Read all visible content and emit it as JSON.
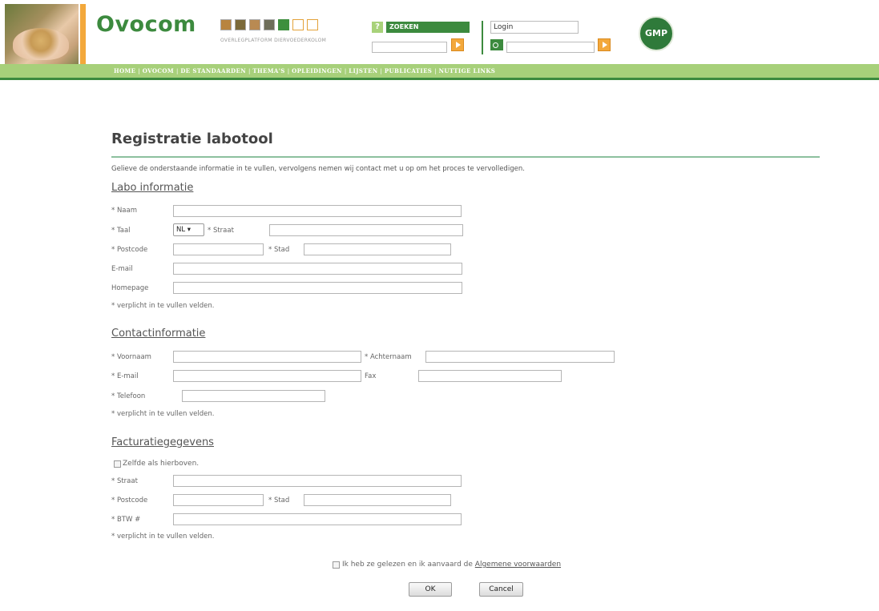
{
  "header": {
    "logo": "Ovocom",
    "tagline": "OVERLEGPLATFORM DIERVOEDERKOLOM",
    "help_icon_glyph": "?",
    "search_label": "ZOEKEN",
    "login_value": "Login",
    "gmp_label": "GMP",
    "accent_color": "#3c8a3e",
    "nav_color": "#a7d07a",
    "button_color": "#f3a83b"
  },
  "nav": [
    "HOME",
    "OVOCOM",
    "DE STANDAARDEN",
    "THEMA'S",
    "OPLEIDINGEN",
    "LIJSTEN",
    "PUBLICATIES",
    "NUTTIGE LINKS"
  ],
  "form": {
    "title": "Registratie labotool",
    "intro": "Gelieve de onderstaande informatie in te vullen, vervolgens nemen wij contact met u op om het proces te vervolledigen.",
    "required_note": "* verplicht in te vullen velden.",
    "labo": {
      "heading": "Labo informatie",
      "naam": "* Naam",
      "taal": "* Taal",
      "taal_value": "NL",
      "straat": "* Straat",
      "postcode": "* Postcode",
      "stad": "* Stad",
      "email": "E-mail",
      "homepage": "Homepage"
    },
    "contact": {
      "heading": "Contactinformatie",
      "voornaam": "* Voornaam",
      "achternaam": "* Achternaam",
      "email": "* E-mail",
      "fax": "Fax",
      "telefoon": "* Telefoon"
    },
    "billing": {
      "heading": "Facturatiegegevens",
      "same_as_above": "Zelfde als hierboven.",
      "straat": "* Straat",
      "postcode": "* Postcode",
      "stad": "* Stad",
      "btw": "* BTW #"
    },
    "agree_text": "Ik heb ze gelezen en ik aanvaard de",
    "terms_link": "Algemene voorwaarden",
    "ok": "OK",
    "cancel": "Cancel"
  }
}
